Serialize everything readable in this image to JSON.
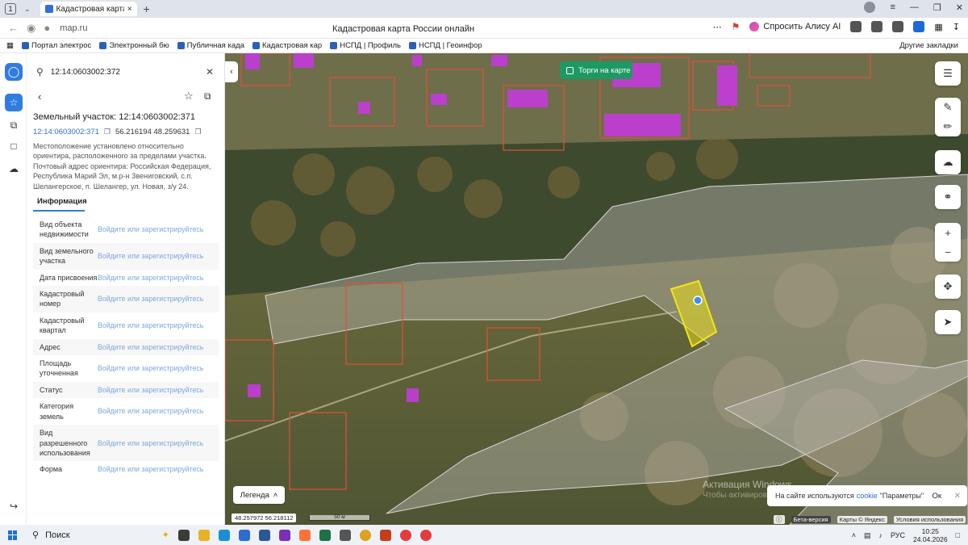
{
  "browser": {
    "tab_count": "1",
    "tab_title": "Кадастровая карта Ро",
    "url": "map.ru",
    "page_title": "Кадастровая карта России онлайн",
    "alisa_label": "Спросить Алису AI",
    "bookmarks": [
      "Портал электрос",
      "Электронный бю",
      "Публичная када",
      "Кадастровая кар",
      "НСПД | Профиль",
      "НСПД | Геоинфор"
    ],
    "other_bookmarks": "Другие закладки"
  },
  "search": {
    "value": "12:14:0603002:372"
  },
  "parcel": {
    "title": "Земельный участок: 12:14:0603002:371",
    "cadastral_number": "12:14:0603002:371",
    "coordinates": "56.216194 48.259631",
    "description": "Местоположение установлено относительно ориентира, расположенного за пределами участка. Почтовый адрес ориентира: Российская Федерация, Республика Марий Эл, м.р-н Звениговский, с.п. Шелангерское, п. Шелангер, ул. Новая, з/у 24.",
    "tab_info": "Информация",
    "rows": [
      {
        "label": "Вид объекта недвижимости",
        "value": "Войдите или зарегистрируйтесь"
      },
      {
        "label": "Вид земельного участка",
        "value": "Войдите или зарегистрируйтесь"
      },
      {
        "label": "Дата присвоения",
        "value": "Войдите или зарегистрируйтесь"
      },
      {
        "label": "Кадастровый номер",
        "value": "Войдите или зарегистрируйтесь"
      },
      {
        "label": "Кадастровый квартал",
        "value": "Войдите или зарегистрируйтесь"
      },
      {
        "label": "Адрес",
        "value": "Войдите или зарегистрируйтесь"
      },
      {
        "label": "Площадь уточненная",
        "value": "Войдите или зарегистрируйтесь"
      },
      {
        "label": "Статус",
        "value": "Войдите или зарегистрируйтесь"
      },
      {
        "label": "Категория земель",
        "value": "Войдите или зарегистрируйтесь"
      },
      {
        "label": "Вид разрешенного использования",
        "value": "Войдите или зарегистрируйтесь"
      },
      {
        "label": "Форма",
        "value": "Войдите или зарегистрируйтесь"
      }
    ]
  },
  "map": {
    "torgi_label": "Торги на карте",
    "legend_label": "Легенда",
    "cursor_coords": "48.257972  56.218112",
    "scale_label": "50 м",
    "cookie_text": "На сайте используются",
    "cookie_link": "cookie",
    "cookie_suffix": "\"Параметры\"",
    "cookie_ok": "Ок",
    "watermark_title": "Активация Windows",
    "watermark_sub": "Чтобы активировать Windows, перейдите в раздел",
    "beta_label": "Бета-версия",
    "attribution": "Карты © Яндекс",
    "terms": "Условия использования"
  },
  "taskbar": {
    "search_label": "Поиск",
    "lang": "РУС",
    "time": "10:25",
    "date": "24.04.2026"
  },
  "colors": {
    "accent": "#2f7de1",
    "torgi_green": "#1d9a63",
    "selected_parcel": "#f2e614",
    "parcel_border": "#e0503c",
    "building_magenta": "#c43adc"
  }
}
